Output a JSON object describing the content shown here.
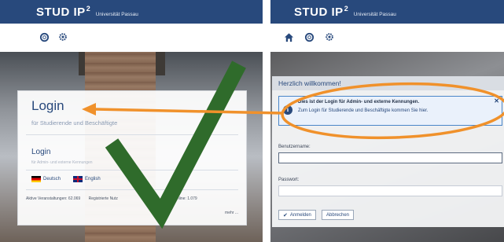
{
  "left": {
    "brand": {
      "name": "STUD IP",
      "version": "2",
      "university": "Universität Passau"
    },
    "icons": [
      "lifebuoy-icon",
      "settings-gear-icon"
    ],
    "card": {
      "title": "Login",
      "subtitle": "für Studierende und Beschäftigte",
      "secondary_link": "Login",
      "secondary_sub": "für Admin- und externe Kennungen",
      "languages": [
        {
          "label": "Deutsch",
          "flag": "de-flag-icon"
        },
        {
          "label": "English",
          "flag": "uk-flag-icon"
        }
      ],
      "stats": {
        "courses": "Aktive Veranstaltungen: 62.069",
        "users": "Registrierte Nutz",
        "online": "Davon online: 1.079"
      },
      "more": "mehr ..."
    }
  },
  "right": {
    "brand": {
      "name": "STUD IP",
      "version": "2",
      "university": "Universität Passau"
    },
    "icons": [
      "home-icon",
      "lifebuoy-icon",
      "settings-gear-icon"
    ],
    "dialog": {
      "title": "Herzlich willkommen!",
      "info_text": "Dies ist der Login für Admin- und externe Kennungen.",
      "info_link": "Zum Login für Studierende und Beschäftigte kommen Sie hier.",
      "username_label": "Benutzername:",
      "password_label": "Passwort:",
      "login_button": "Anmelden",
      "cancel_button": "Abbrechen"
    }
  },
  "annotations": {
    "arrow_color": "#f0912b",
    "check_color": "#2f6b2b"
  },
  "colors": {
    "header": "#28497c",
    "accent": "#28497c"
  }
}
